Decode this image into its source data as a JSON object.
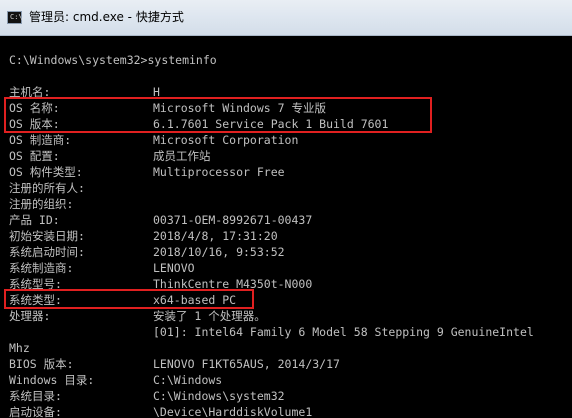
{
  "window": {
    "title": "管理员: cmd.exe - 快捷方式",
    "icon": "cmd-console-icon"
  },
  "console": {
    "prompt": "C:\\Windows\\system32>systeminfo",
    "rows": [
      {
        "label": "主机名:",
        "value": "H"
      },
      {
        "label": "OS 名称:",
        "value": "Microsoft Windows 7 专业版"
      },
      {
        "label": "OS 版本:",
        "value": "6.1.7601 Service Pack 1 Build 7601"
      },
      {
        "label": "OS 制造商:",
        "value": "Microsoft Corporation"
      },
      {
        "label": "OS 配置:",
        "value": "成员工作站"
      },
      {
        "label": "OS 构件类型:",
        "value": "Multiprocessor Free"
      },
      {
        "label": "注册的所有人:",
        "value": ""
      },
      {
        "label": "注册的组织:",
        "value": ""
      },
      {
        "label": "产品 ID:",
        "value": "00371-OEM-8992671-00437"
      },
      {
        "label": "初始安装日期:",
        "value": "2018/4/8, 17:31:20"
      },
      {
        "label": "系统启动时间:",
        "value": "2018/10/16, 9:53:52"
      },
      {
        "label": "系统制造商:",
        "value": "LENOVO"
      },
      {
        "label": "系统型号:",
        "value": "ThinkCentre M4350t-N000"
      },
      {
        "label": "系统类型:",
        "value": "x64-based PC"
      },
      {
        "label": "处理器:",
        "value": "安装了 1 个处理器。"
      },
      {
        "label": "",
        "value": "[01]: Intel64 Family 6 Model 58 Stepping 9 GenuineIntel"
      },
      {
        "label": "Mhz",
        "value": ""
      },
      {
        "label": "BIOS 版本:",
        "value": "LENOVO F1KT65AUS, 2014/3/17"
      },
      {
        "label": "Windows 目录:",
        "value": "C:\\Windows"
      },
      {
        "label": "系统目录:",
        "value": "C:\\Windows\\system32"
      },
      {
        "label": "启动设备:",
        "value": "\\Device\\HarddiskVolume1"
      }
    ]
  },
  "colors": {
    "console_bg": "#000000",
    "console_text": "#c0c0c0",
    "highlight": "#e02020"
  }
}
